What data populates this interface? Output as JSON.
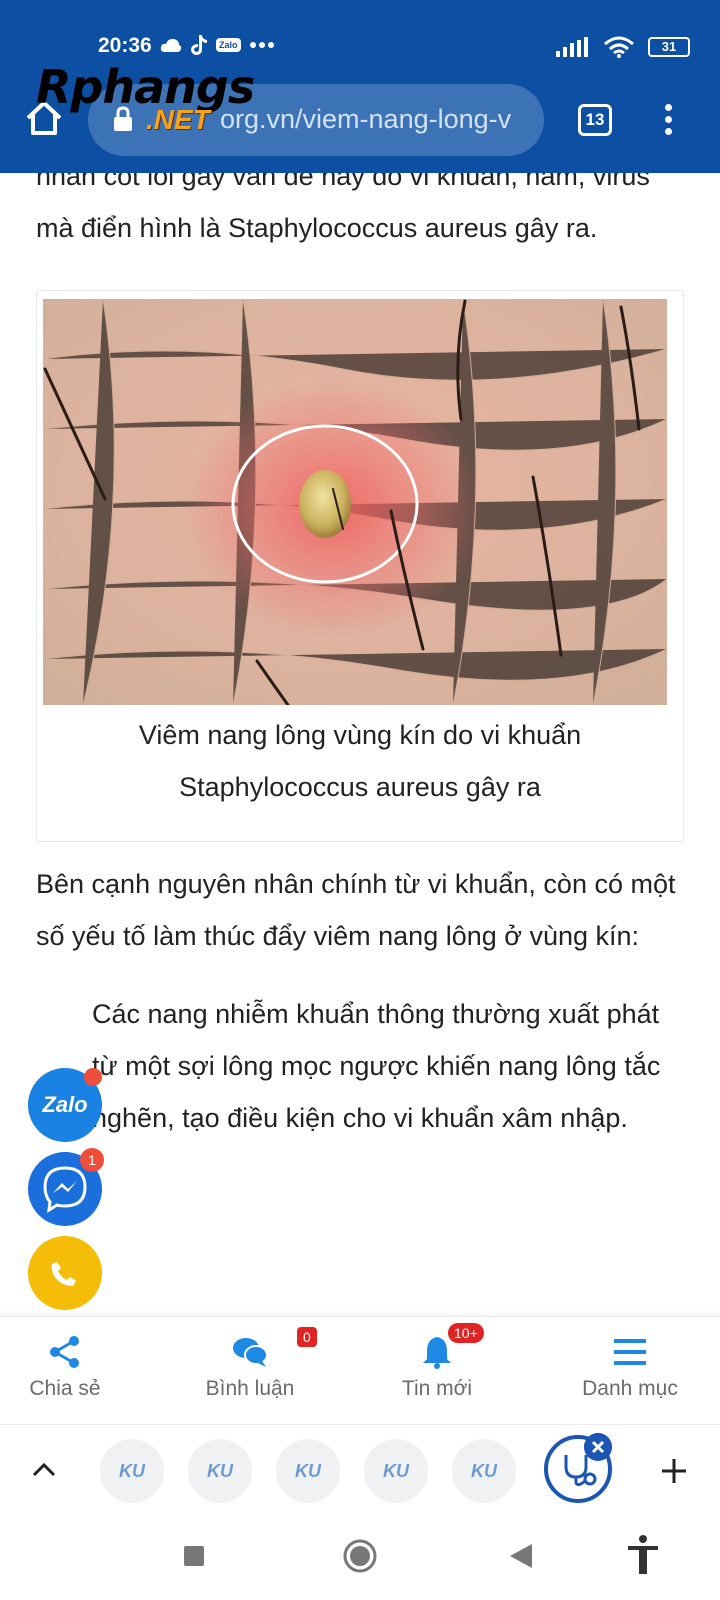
{
  "status_bar": {
    "time": "20:36",
    "battery": "31",
    "left_icons": [
      "cloud-icon",
      "tiktok-icon",
      "zalo-icon",
      "more-dots-icon"
    ],
    "right_icons": [
      "signal-icon",
      "wifi-icon",
      "battery-icon"
    ]
  },
  "browser": {
    "brand": "Rphangs",
    "brand_suffix": ".NET",
    "url": "org.vn/viem-nang-long-v",
    "tab_count": "13",
    "colors": {
      "toolbar": "#0d4fa3",
      "urlbar": "#3c73b7"
    }
  },
  "article": {
    "paragraph_top": "nhân cốt lõi gây vấn đề này do vi khuẩn, nấm, virus mà điển hình là Staphylococcus aureus gây ra.",
    "figure_caption": "Viêm nang lông vùng kín do vi khuẩn Staphylococcus aureus gây ra",
    "paragraph_2": "Bên cạnh nguyên nhân chính từ vi khuẩn, còn có một số yếu tố làm thúc đẩy viêm nang lông ở vùng kín:",
    "bullet_1": "Các nang nhiễm khuẩn thông thường xuất phát từ một sợi lông mọc ngược khiến nang lông tắc nghẽn, tạo điều kiện cho vi khuẩn xâm nhập."
  },
  "floating_buttons": {
    "zalo_label": "Zalo",
    "messenger_badge": "1"
  },
  "bottom_nav": {
    "items": [
      {
        "label": "Chia sẻ",
        "icon": "share-icon"
      },
      {
        "label": "Bình luận",
        "icon": "comment-icon",
        "badge": "0"
      },
      {
        "label": "Tin mới",
        "icon": "bell-icon",
        "badge": "10+"
      },
      {
        "label": "Danh mục",
        "icon": "menu-lines-icon"
      }
    ],
    "accent": "#1e88e5"
  },
  "tab_strip": {
    "chips": [
      "KU",
      "KU",
      "KU",
      "KU",
      "KU"
    ]
  }
}
